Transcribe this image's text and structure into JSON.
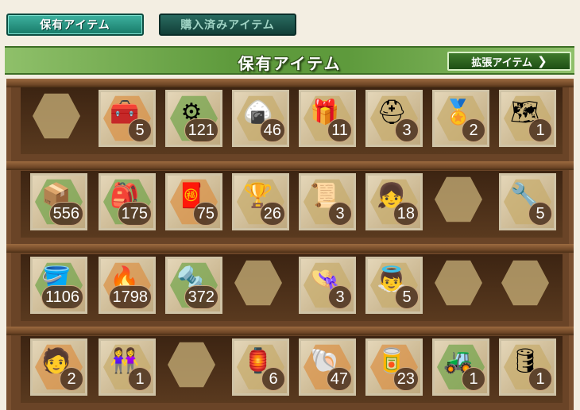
{
  "tabs": {
    "owned": "保有アイテム",
    "purchased": "購入済みアイテム"
  },
  "header": {
    "title": "保有アイテム",
    "extension_button": "拡張アイテム",
    "extension_chevron": "❯"
  },
  "rows": [
    [
      {
        "empty": true
      },
      {
        "name": "red-case-icon",
        "glyph": "🧰",
        "bg": "orange",
        "count": "5"
      },
      {
        "name": "gear-bolt-icon",
        "glyph": "⚙",
        "bg": "green",
        "count": "121"
      },
      {
        "name": "food-icon",
        "glyph": "🍙",
        "bg": "tan",
        "count": "46"
      },
      {
        "name": "present-box-icon",
        "glyph": "🎁",
        "bg": "tan",
        "count": "11"
      },
      {
        "name": "helmet-icon",
        "glyph": "⛑",
        "bg": "tan",
        "count": "3"
      },
      {
        "name": "medal-icon",
        "glyph": "🏅",
        "bg": "tan",
        "count": "2"
      },
      {
        "name": "chibi-map-icon",
        "glyph": "🗺",
        "bg": "tan",
        "count": "1"
      }
    ],
    [
      {
        "name": "brown-chest-icon",
        "glyph": "📦",
        "bg": "green",
        "count": "556"
      },
      {
        "name": "purple-chest-icon",
        "glyph": "🎒",
        "bg": "green",
        "count": "175"
      },
      {
        "name": "red-chest-icon",
        "glyph": "🧧",
        "bg": "orange",
        "count": "75"
      },
      {
        "name": "trophy-cup-icon",
        "glyph": "🏆",
        "bg": "tan",
        "count": "26"
      },
      {
        "name": "blueprint-icon",
        "glyph": "📜",
        "bg": "tan",
        "count": "3"
      },
      {
        "name": "chibi-girl-icon",
        "glyph": "👧",
        "bg": "tan",
        "count": "18"
      },
      {
        "empty": true
      },
      {
        "name": "chibi-repair-icon",
        "glyph": "🔧",
        "bg": "tan",
        "count": "5"
      }
    ],
    [
      {
        "name": "green-bucket-icon",
        "glyph": "🪣",
        "bg": "green",
        "count": "1106"
      },
      {
        "name": "flame-tool-icon",
        "glyph": "🔥",
        "bg": "orange",
        "count": "1798"
      },
      {
        "name": "screw-icon",
        "glyph": "🔩",
        "bg": "green",
        "count": "372"
      },
      {
        "empty": true
      },
      {
        "name": "chibi-cap-icon",
        "glyph": "👒",
        "bg": "tan",
        "count": "3"
      },
      {
        "name": "chibi-angel-icon",
        "glyph": "👼",
        "bg": "tan",
        "count": "5"
      },
      {
        "empty": true
      },
      {
        "empty": true
      }
    ],
    [
      {
        "name": "chibi-pilot-icon",
        "glyph": "🧑",
        "bg": "orange",
        "count": "2"
      },
      {
        "name": "chibi-duo-icon",
        "glyph": "👭",
        "bg": "tan",
        "count": "1"
      },
      {
        "empty": true
      },
      {
        "name": "lantern-icon",
        "glyph": "🏮",
        "bg": "tan",
        "count": "6"
      },
      {
        "name": "shell-icon",
        "glyph": "🐚",
        "bg": "orange",
        "count": "47"
      },
      {
        "name": "supply-crate-icon",
        "glyph": "🥫",
        "bg": "orange",
        "count": "23"
      },
      {
        "name": "bulldozer-icon",
        "glyph": "🚜",
        "bg": "green",
        "count": "1"
      },
      {
        "name": "drum-canister-icon",
        "glyph": "🛢",
        "bg": "tan",
        "count": "1"
      }
    ]
  ]
}
